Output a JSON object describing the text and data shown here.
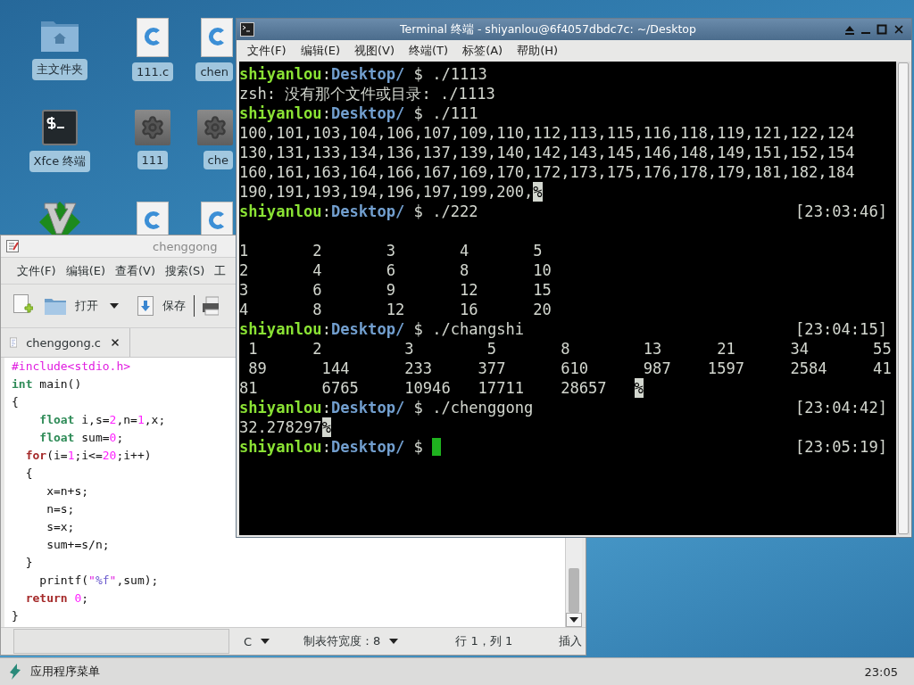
{
  "desktop": {
    "icons": [
      {
        "kind": "home-folder",
        "label": "主文件夹"
      },
      {
        "kind": "c-file",
        "label": "111.c"
      },
      {
        "kind": "c-file",
        "label": "chen"
      },
      {
        "kind": "terminal",
        "label": "Xfce 终端"
      },
      {
        "kind": "executable",
        "label": "111"
      },
      {
        "kind": "executable",
        "label": "che"
      },
      {
        "kind": "vim"
      },
      {
        "kind": "c-file"
      },
      {
        "kind": "c-file"
      }
    ]
  },
  "editor": {
    "title": "chenggong",
    "menu": [
      "文件(F)",
      "编辑(E)",
      "查看(V)",
      "搜索(S)",
      "工"
    ],
    "toolbar": [
      {
        "kind": "new"
      },
      {
        "kind": "open",
        "label": "打开"
      },
      {
        "kind": "dropdown"
      },
      {
        "kind": "save",
        "label": "保存"
      },
      {
        "kind": "separator"
      },
      {
        "kind": "print"
      }
    ],
    "tabs": [
      {
        "label": "chenggong.c",
        "selected": true
      }
    ],
    "code": [
      [
        {
          "t": "#include<stdio.h>",
          "kind": "preproc"
        }
      ],
      [
        {
          "t": "int",
          "kind": "type"
        },
        {
          "t": " main()",
          "kind": "plain"
        }
      ],
      [
        {
          "t": "{",
          "kind": "plain"
        }
      ],
      [
        {
          "t": "    float",
          "kind": "type"
        },
        {
          "t": " i,s=",
          "kind": "plain"
        },
        {
          "t": "2",
          "kind": "number"
        },
        {
          "t": ",n=",
          "kind": "plain"
        },
        {
          "t": "1",
          "kind": "number"
        },
        {
          "t": ",x;",
          "kind": "plain"
        }
      ],
      [
        {
          "t": "    float",
          "kind": "type"
        },
        {
          "t": " sum=",
          "kind": "plain"
        },
        {
          "t": "0",
          "kind": "number"
        },
        {
          "t": ";",
          "kind": "plain"
        }
      ],
      [
        {
          "t": "  for",
          "kind": "keyword"
        },
        {
          "t": "(i=",
          "kind": "plain"
        },
        {
          "t": "1",
          "kind": "number"
        },
        {
          "t": ";i<=",
          "kind": "plain"
        },
        {
          "t": "20",
          "kind": "number"
        },
        {
          "t": ";i++)",
          "kind": "plain"
        }
      ],
      [
        {
          "t": "  {",
          "kind": "plain"
        }
      ],
      [
        {
          "t": "     x=n+s;",
          "kind": "plain"
        }
      ],
      [
        {
          "t": "     n=s;",
          "kind": "plain"
        }
      ],
      [
        {
          "t": "     s=x;",
          "kind": "plain"
        }
      ],
      [
        {
          "t": "     sum+=s/n;",
          "kind": "plain"
        }
      ],
      [
        {
          "t": "  }",
          "kind": "plain"
        }
      ],
      [
        {
          "t": "    printf(",
          "kind": "plain"
        },
        {
          "t": "\"",
          "kind": "string"
        },
        {
          "t": "%f",
          "kind": "format"
        },
        {
          "t": "\"",
          "kind": "string"
        },
        {
          "t": ",sum);",
          "kind": "plain"
        }
      ],
      [
        {
          "t": "  return",
          "kind": "keyword"
        },
        {
          "t": " 0",
          "kind": "number"
        },
        {
          "t": ";",
          "kind": "plain"
        }
      ],
      [
        {
          "t": "}",
          "kind": "plain"
        }
      ]
    ],
    "status": {
      "language": "C",
      "tab_width": "制表符宽度：8",
      "position": "行 1，列 1",
      "mode": "插入"
    }
  },
  "terminal": {
    "title": "Terminal 终端 - shiyanlou@6f4057dbdc7c: ~/Desktop",
    "menu": [
      "文件(F)",
      "编辑(E)",
      "视图(V)",
      "终端(T)",
      "标签(A)",
      "帮助(H)"
    ],
    "lines": [
      {
        "kind": "prompt",
        "user": "shiyanlou",
        "sep": ":",
        "dir": "Desktop/",
        "symbol": "$",
        "command": "./1113"
      },
      {
        "kind": "output",
        "text": "zsh: 没有那个文件或目录: ./1113"
      },
      {
        "kind": "prompt",
        "user": "shiyanlou",
        "sep": ":",
        "dir": "Desktop/",
        "symbol": "$",
        "command": "./111"
      },
      {
        "kind": "output",
        "text": "100,101,103,104,106,107,109,110,112,113,115,116,118,119,121,122,124"
      },
      {
        "kind": "output",
        "text": "130,131,133,134,136,137,139,140,142,143,145,146,148,149,151,152,154"
      },
      {
        "kind": "output",
        "text": "160,161,163,164,166,167,169,170,172,173,175,176,178,179,181,182,184"
      },
      {
        "kind": "output",
        "text": "190,191,193,194,196,197,199,200,",
        "end_mark": "%"
      },
      {
        "kind": "prompt",
        "user": "shiyanlou",
        "sep": ":",
        "dir": "Desktop/",
        "symbol": "$",
        "command": "./222",
        "time": "[23:03:46]"
      },
      {
        "kind": "blank"
      },
      {
        "kind": "output",
        "text": "1       2       3       4       5"
      },
      {
        "kind": "output",
        "text": "2       4       6       8       10"
      },
      {
        "kind": "output",
        "text": "3       6       9       12      15"
      },
      {
        "kind": "output",
        "text": "4       8       12      16      20"
      },
      {
        "kind": "prompt",
        "user": "shiyanlou",
        "sep": ":",
        "dir": "Desktop/",
        "symbol": "$",
        "command": "./changshi",
        "time": "[23:04:15]"
      },
      {
        "kind": "output",
        "text": " 1      2         3        5       8        13      21      34       55"
      },
      {
        "kind": "output",
        "text": " 89      144      233     377      610      987    1597     2584     41"
      },
      {
        "kind": "output",
        "text": "81       6765     10946   17711    28657   ",
        "end_mark": "%"
      },
      {
        "kind": "prompt",
        "user": "shiyanlou",
        "sep": ":",
        "dir": "Desktop/",
        "symbol": "$",
        "command": "./chenggong",
        "time": "[23:04:42]"
      },
      {
        "kind": "output",
        "text": "32.278297",
        "end_mark": "%"
      },
      {
        "kind": "prompt",
        "user": "shiyanlou",
        "sep": ":",
        "dir": "Desktop/",
        "symbol": "$",
        "time": "[23:05:19]",
        "cursor": true
      }
    ]
  },
  "taskbar": {
    "menu_label": "应用程序菜单",
    "clock": "23:05"
  }
}
